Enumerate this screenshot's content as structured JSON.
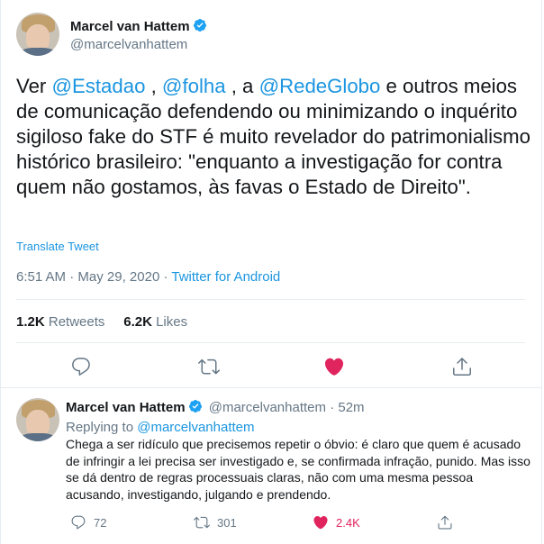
{
  "tweet": {
    "author_name": "Marcel van Hattem",
    "author_handle": "@marcelvanhattem",
    "text_parts": [
      {
        "t": "Ver ",
        "m": false
      },
      {
        "t": "@Estadao",
        "m": true
      },
      {
        "t": " , ",
        "m": false
      },
      {
        "t": "@folha",
        "m": true
      },
      {
        "t": " , a ",
        "m": false
      },
      {
        "t": "@RedeGlobo",
        "m": true
      },
      {
        "t": " e outros meios de comunicação defendendo ou minimizando o inquérito sigiloso fake do STF é muito revelador do patrimonialismo histórico brasileiro: \"enquanto a investigação for contra quem não gostamos, às favas o Estado de Direito\".",
        "m": false
      }
    ],
    "translate_label": "Translate Tweet",
    "time": "6:51 AM",
    "dot": "·",
    "date": "May 29, 2020",
    "source": "Twitter for Android",
    "retweets_count": "1.2K",
    "retweets_label": "Retweets",
    "likes_count": "6.2K",
    "likes_label": "Likes"
  },
  "reply": {
    "author_name": "Marcel van Hattem",
    "author_handle": "@marcelvanhattem",
    "dot": "·",
    "age": "52m",
    "replying_prefix": "Replying to ",
    "replying_to": "@marcelvanhattem",
    "text": "Chega a ser ridículo que precisemos repetir o óbvio: é claro que quem é acusado de infringir a lei precisa ser investigado e, se confirmada infração, punido. Mas isso se dá dentro de regras processuais claras, não com uma mesma pessoa acusando, investigando, julgando e prendendo.",
    "replies_count": "72",
    "retweets_count": "301",
    "likes_count": "2.4K"
  },
  "colors": {
    "accent": "#1b95e0",
    "like": "#e0245e",
    "muted": "#657786"
  }
}
